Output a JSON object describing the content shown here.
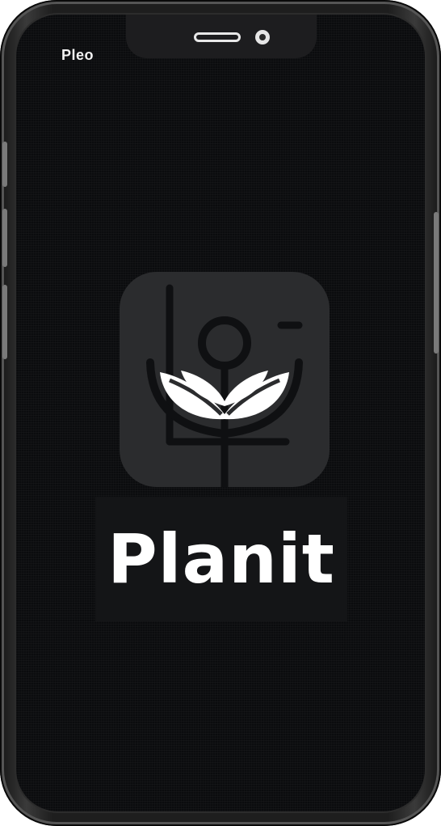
{
  "status_bar": {
    "carrier": "Pleo"
  },
  "app": {
    "name": "Planit",
    "icon": "plant-camera-icon"
  },
  "colors": {
    "screen_background": "#0b0c0e",
    "icon_background": "#2b2c2e",
    "logo_foreground": "#ffffff"
  }
}
